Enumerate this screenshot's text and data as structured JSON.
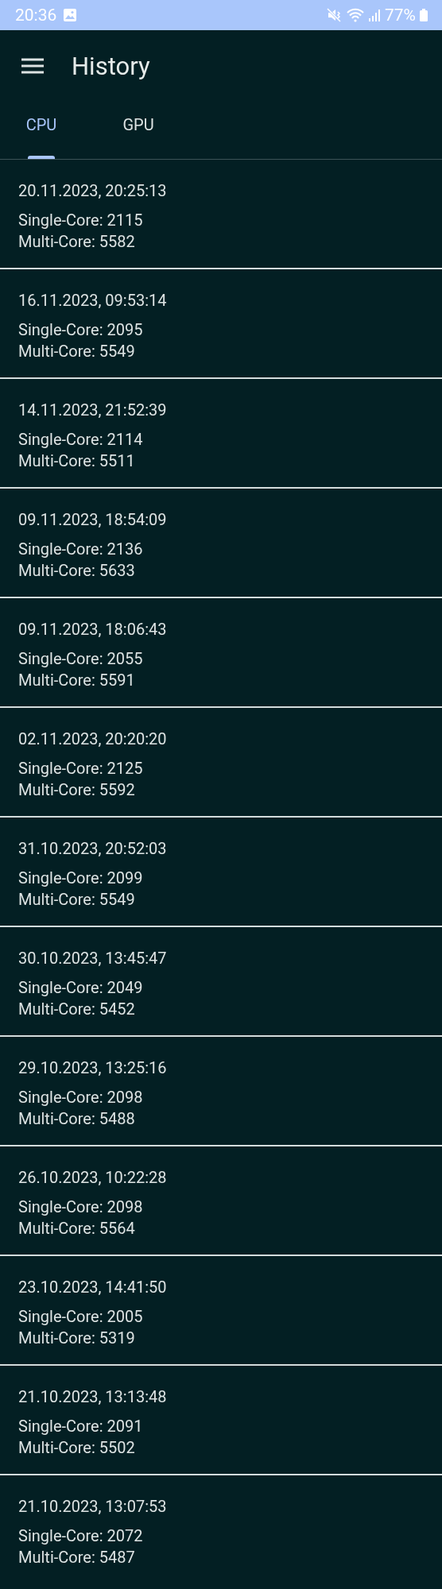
{
  "status_bar": {
    "time": "20:36",
    "battery": "77%"
  },
  "app_bar": {
    "title": "History"
  },
  "tabs": [
    {
      "label": "CPU",
      "selected": true
    },
    {
      "label": "GPU",
      "selected": false
    }
  ],
  "results": [
    {
      "date": "20.11.2023, 20:25:13",
      "single": "Single-Core: 2115",
      "multi": "Multi-Core: 5582"
    },
    {
      "date": "16.11.2023, 09:53:14",
      "single": "Single-Core: 2095",
      "multi": "Multi-Core: 5549"
    },
    {
      "date": "14.11.2023, 21:52:39",
      "single": "Single-Core: 2114",
      "multi": "Multi-Core: 5511"
    },
    {
      "date": "09.11.2023, 18:54:09",
      "single": "Single-Core: 2136",
      "multi": "Multi-Core: 5633"
    },
    {
      "date": "09.11.2023, 18:06:43",
      "single": "Single-Core: 2055",
      "multi": "Multi-Core: 5591"
    },
    {
      "date": "02.11.2023, 20:20:20",
      "single": "Single-Core: 2125",
      "multi": "Multi-Core: 5592"
    },
    {
      "date": "31.10.2023, 20:52:03",
      "single": "Single-Core: 2099",
      "multi": "Multi-Core: 5549"
    },
    {
      "date": "30.10.2023, 13:45:47",
      "single": "Single-Core: 2049",
      "multi": "Multi-Core: 5452"
    },
    {
      "date": "29.10.2023, 13:25:16",
      "single": "Single-Core: 2098",
      "multi": "Multi-Core: 5488"
    },
    {
      "date": "26.10.2023, 10:22:28",
      "single": "Single-Core: 2098",
      "multi": "Multi-Core: 5564"
    },
    {
      "date": "23.10.2023, 14:41:50",
      "single": "Single-Core: 2005",
      "multi": "Multi-Core: 5319"
    },
    {
      "date": "21.10.2023, 13:13:48",
      "single": "Single-Core: 2091",
      "multi": "Multi-Core: 5502"
    },
    {
      "date": "21.10.2023, 13:07:53",
      "single": "Single-Core: 2072",
      "multi": "Multi-Core: 5487"
    }
  ]
}
